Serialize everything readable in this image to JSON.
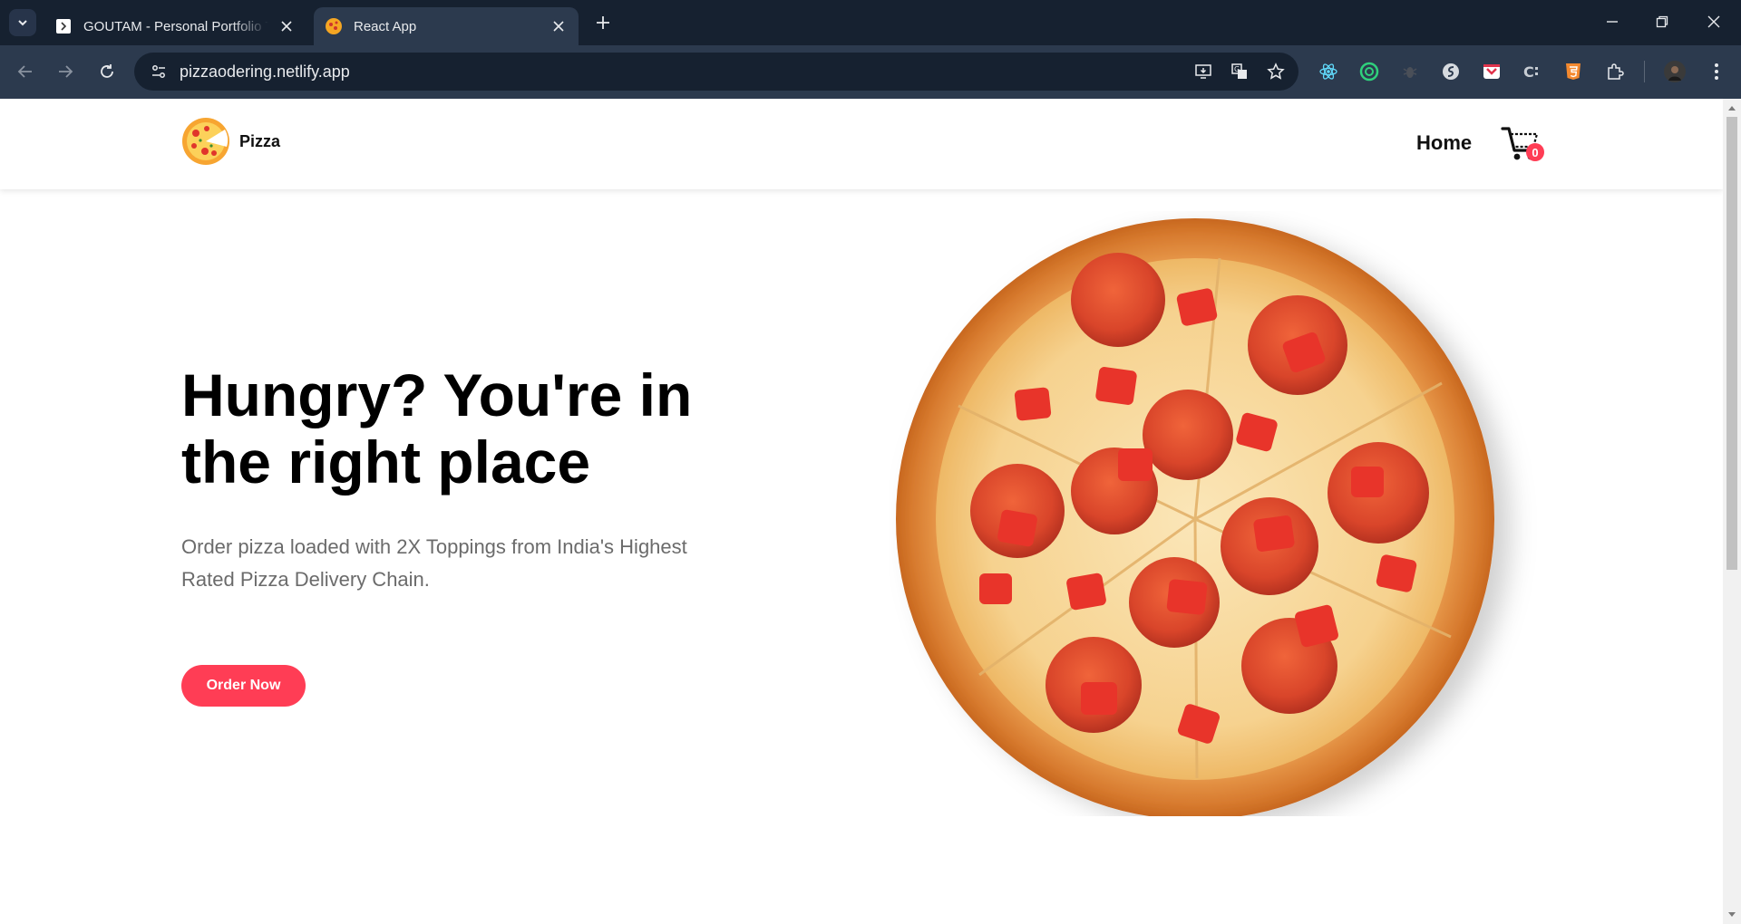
{
  "browser": {
    "tabs": [
      {
        "title": "GOUTAM - Personal Portfolio Template",
        "active": false
      },
      {
        "title": "React App",
        "active": true
      }
    ],
    "url": "pizzaodering.netlify.app"
  },
  "site": {
    "brand": "Pizza",
    "nav": {
      "home": "Home"
    },
    "cart_count": "0"
  },
  "hero": {
    "title": "Hungry? You're in the right place",
    "subtitle": "Order pizza loaded with 2X Toppings from India's Highest Rated Pizza Delivery Chain.",
    "cta": "Order Now"
  },
  "colors": {
    "accent": "#ff3d55",
    "chrome_bg": "#162130",
    "toolbar_bg": "#2c3a4e"
  }
}
